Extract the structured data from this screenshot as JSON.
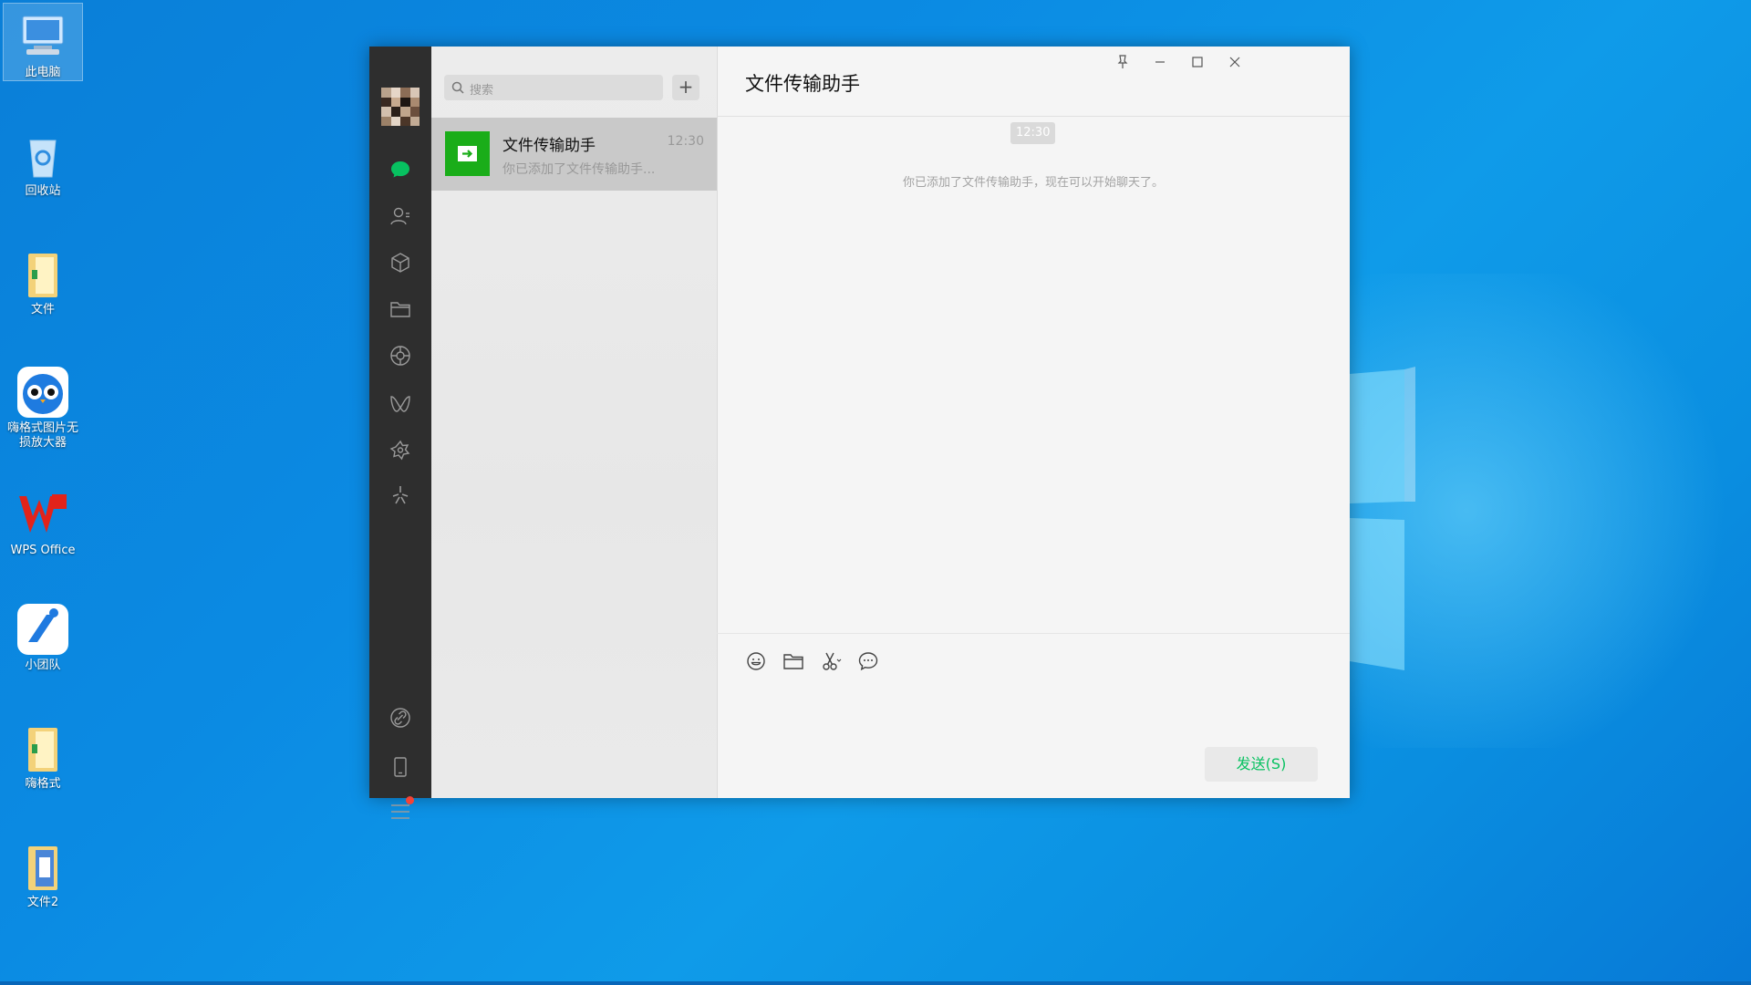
{
  "desktop": {
    "icons": [
      {
        "label": "此电脑",
        "icon": "computer-icon"
      },
      {
        "label": "回收站",
        "icon": "recycle-bin-icon"
      },
      {
        "label": "文件",
        "icon": "folder-icon"
      },
      {
        "label": "嗨格式图片无损放大器",
        "icon": "owl-app-icon"
      },
      {
        "label": "WPS Office",
        "icon": "wps-icon"
      },
      {
        "label": "小团队",
        "icon": "team-app-icon"
      },
      {
        "label": "嗨格式",
        "icon": "folder-icon"
      },
      {
        "label": "文件2",
        "icon": "folder-blue-icon"
      }
    ]
  },
  "wechat": {
    "search": {
      "placeholder": "搜索"
    },
    "add_label": "+",
    "nav": [
      "chat-icon",
      "contacts-icon",
      "favorites-icon",
      "files-icon",
      "moments-icon",
      "channels-icon",
      "miniprogram-icon",
      "search-discover-icon",
      "link-icon",
      "phone-icon",
      "menu-icon"
    ],
    "chat_list": [
      {
        "name": "文件传输助手",
        "time": "12:30",
        "preview": "你已添加了文件传输助手..."
      }
    ],
    "main": {
      "title": "文件传输助手",
      "timestamp": "12:30",
      "system_message": "你已添加了文件传输助手，现在可以开始聊天了。",
      "send_label": "发送(S)"
    },
    "colors": {
      "accent": "#07c160",
      "nav_bg": "#2e2e2e",
      "selected_item": "#c9c9c9"
    }
  }
}
